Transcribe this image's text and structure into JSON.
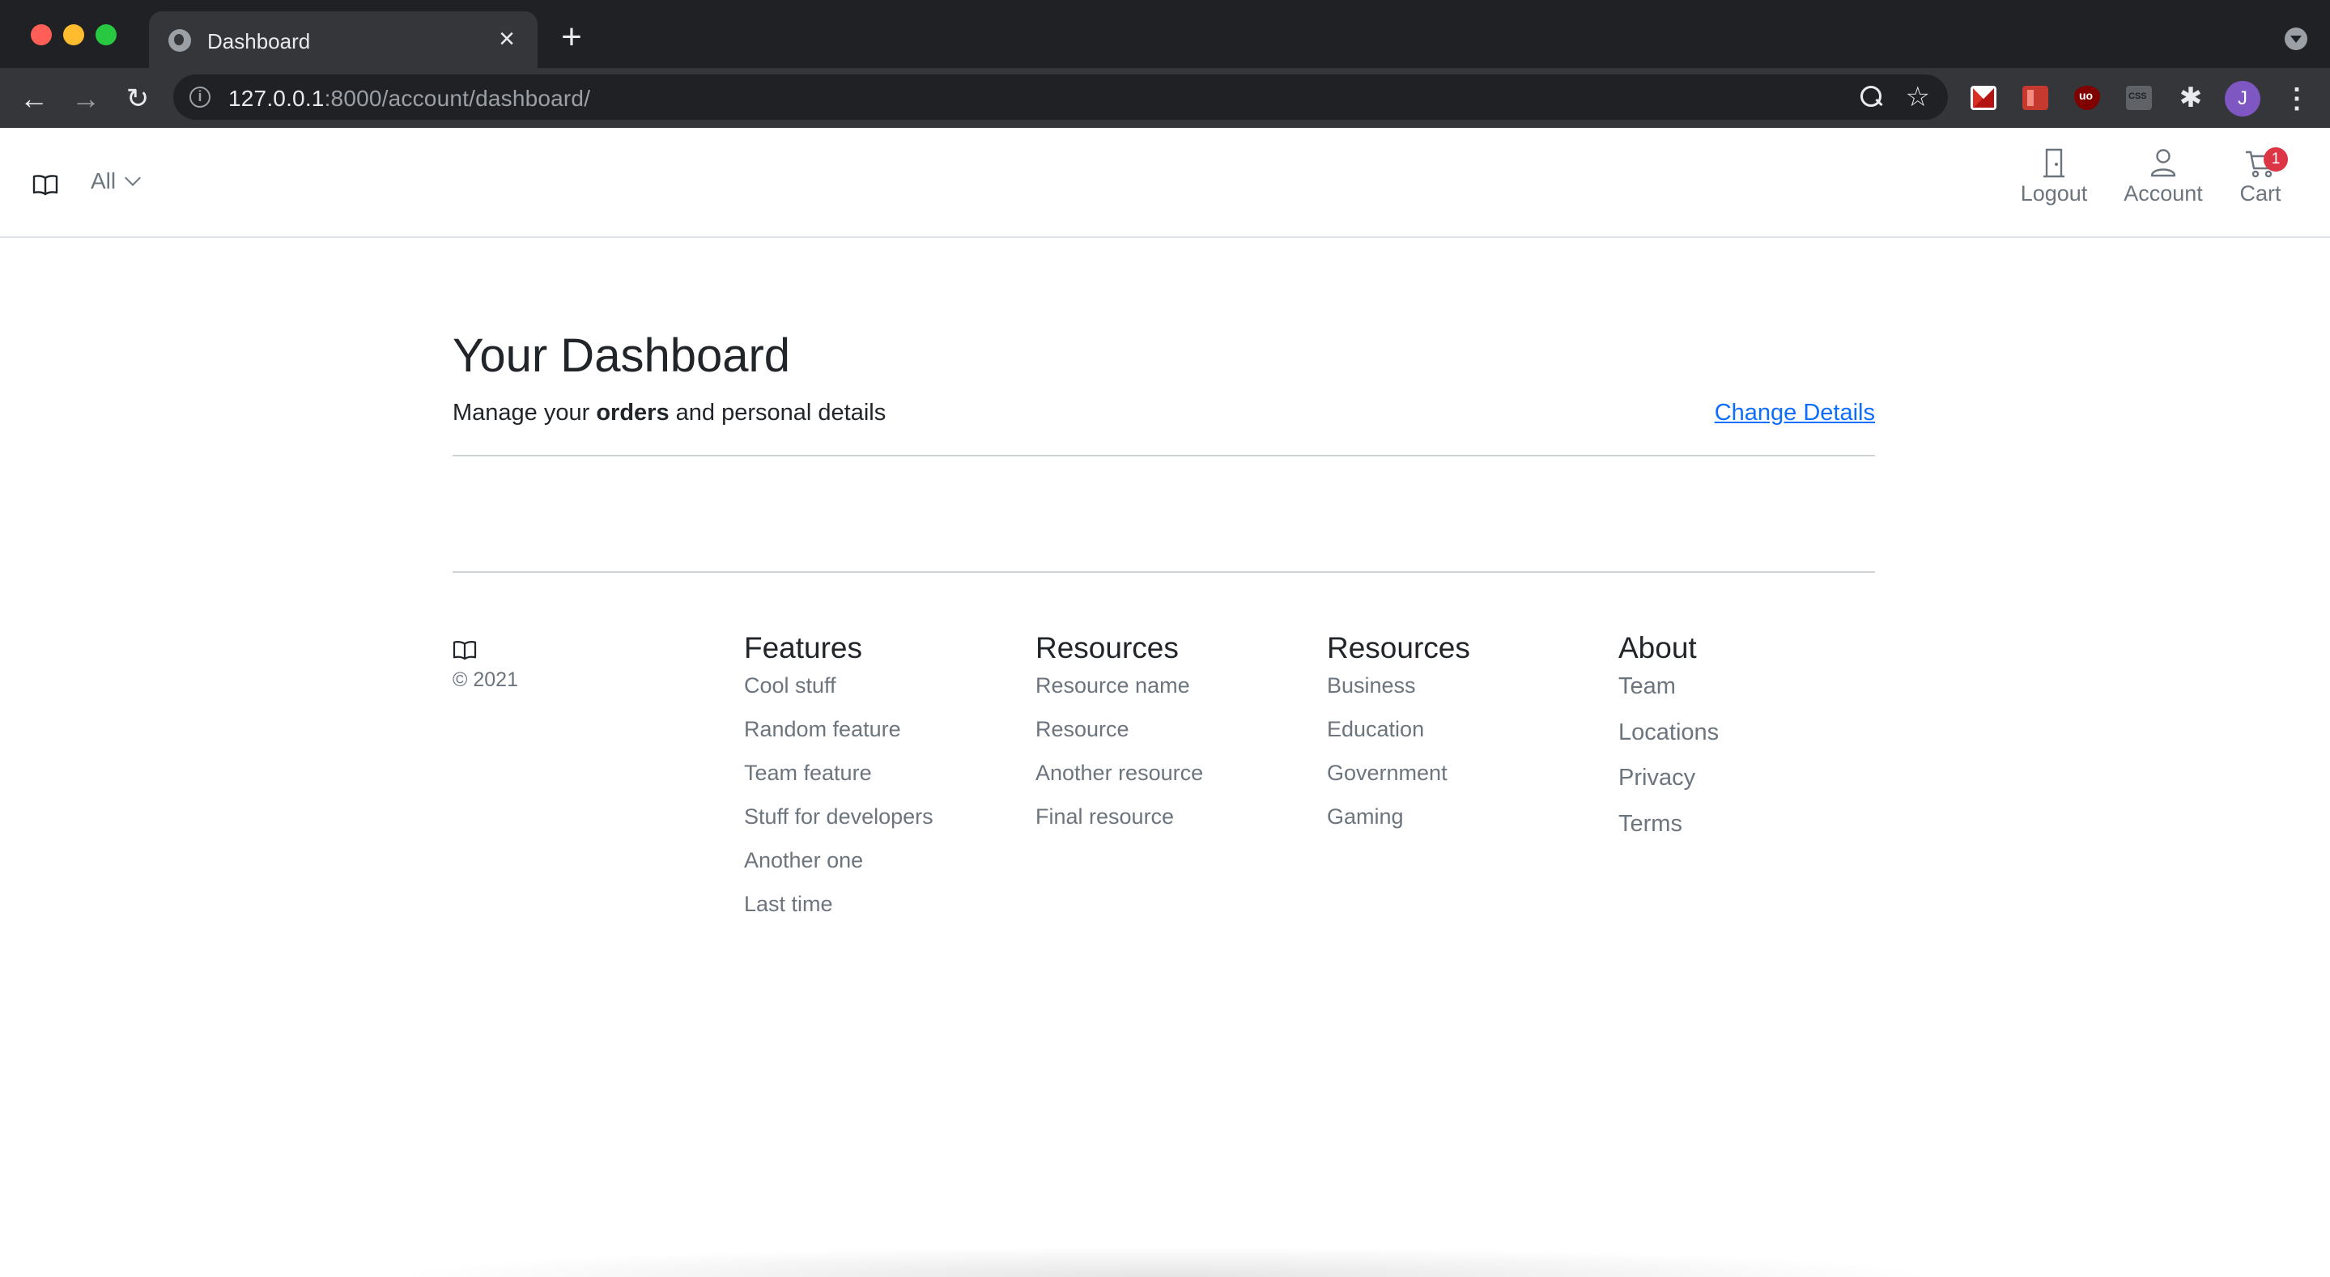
{
  "browser": {
    "tab_title": "Dashboard",
    "tab_close": "×",
    "new_tab": "+",
    "url_host": "127.0.0.1",
    "url_path": ":8000/account/dashboard/",
    "profile_initial": "J",
    "back": "←",
    "forward": "→",
    "reload": "↻",
    "star": "☆",
    "menu": "⋮",
    "info": "i"
  },
  "header": {
    "category": "All",
    "actions": {
      "logout": "Logout",
      "account": "Account",
      "cart": "Cart"
    },
    "cart_count": "1"
  },
  "main": {
    "title": "Your Dashboard",
    "subtitle_before": "Manage your ",
    "subtitle_bold": "orders",
    "subtitle_after": " and personal details",
    "change_details": "Change Details"
  },
  "footer": {
    "copyright": "© 2021",
    "columns": [
      {
        "title": "Features",
        "items": [
          "Cool stuff",
          "Random feature",
          "Team feature",
          "Stuff for developers",
          "Another one",
          "Last time"
        ]
      },
      {
        "title": "Resources",
        "items": [
          "Resource name",
          "Resource",
          "Another resource",
          "Final resource"
        ]
      },
      {
        "title": "Resources",
        "items": [
          "Business",
          "Education",
          "Government",
          "Gaming"
        ]
      },
      {
        "title": "About",
        "items": [
          "Team",
          "Locations",
          "Privacy",
          "Terms"
        ]
      }
    ]
  },
  "colors": {
    "link": "#0d6efd",
    "badge": "#dc3545",
    "muted": "#6c757d",
    "profile": "#7e57c2"
  }
}
